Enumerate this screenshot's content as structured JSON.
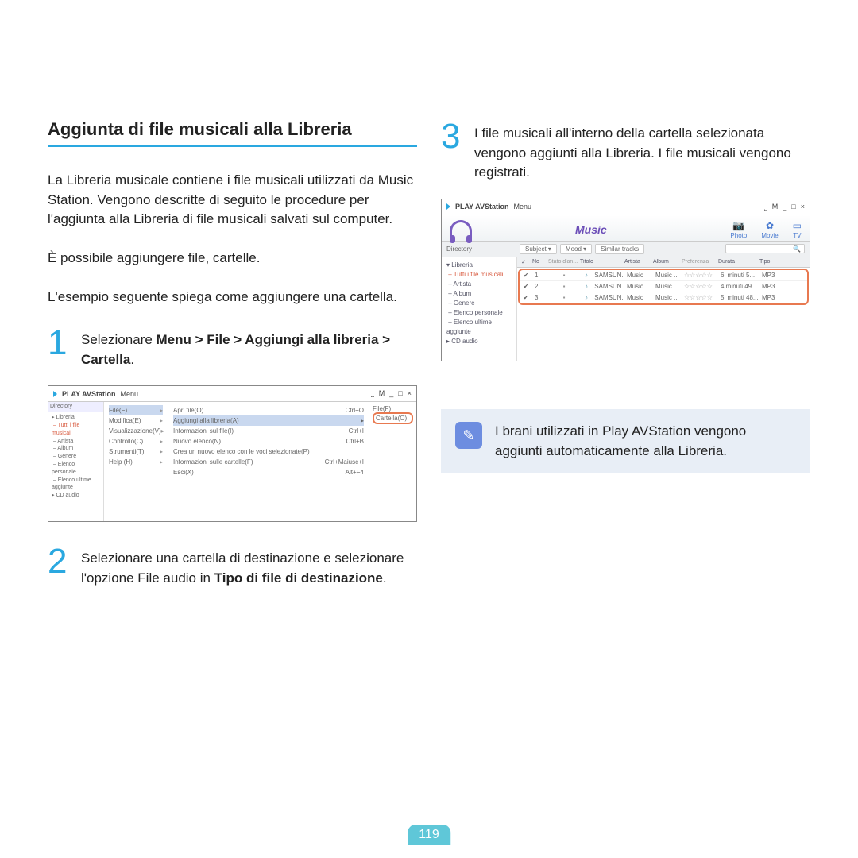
{
  "heading": "Aggiunta di file musicali alla Libreria",
  "intro1": "La Libreria musicale contiene i file musicali utilizzati da Music Station. Vengono descritte di seguito le procedure per l'aggiunta alla Libreria di file musicali salvati sul computer.",
  "intro2": "È possibile aggiungere file, cartelle.",
  "intro3": "L'esempio seguente spiega come aggiungere una cartella.",
  "step1_pre": "Selezionare ",
  "step1_bold": "Menu > File > Aggiungi alla libreria > Cartella",
  "step1_post": ".",
  "step2_a": "Selezionare una cartella di destinazione e selezionare l'opzione File audio in ",
  "step2_b": "Tipo di file di destinazione",
  "step2_c": ".",
  "step3": "I file musicali all'interno della cartella selezionata vengono aggiunti alla Libreria. I file musicali vengono registrati.",
  "note": "I brani utilizzati in Play AVStation vengono aggiunti automaticamente alla Libreria.",
  "pagenum": "119",
  "shot1": {
    "app": "PLAY AVStation",
    "menu_label": "Menu",
    "win_btns": [
      "⎵",
      "M",
      "_",
      "□",
      "×"
    ],
    "dir_label": "Directory",
    "tree": [
      "Libreria",
      "Tutti i file musicali",
      "Artista",
      "Album",
      "Genere",
      "Elenco personale",
      "Elenco ultime aggiunte",
      "CD audio"
    ],
    "filemenu": [
      "File(F)",
      "Modifica(E)",
      "Visualizzazione(V)",
      "Controllo(C)",
      "Strumenti(T)",
      "Help (H)"
    ],
    "submenu": [
      {
        "l": "Apri file(O)",
        "r": "Ctrl+O"
      },
      {
        "l": "Aggiungi alla libreria(A)",
        "r": ""
      },
      {
        "l": "Informazioni sul file(I)",
        "r": "Ctrl+I"
      },
      {
        "l": "Nuovo elenco(N)",
        "r": "Ctrl+B"
      },
      {
        "l": "Crea un nuovo elenco con le voci selezionate(P)",
        "r": ""
      },
      {
        "l": "Informazioni sulle cartelle(F)",
        "r": "Ctrl+Maiusc+I"
      },
      {
        "l": "Esci(X)",
        "r": "Alt+F4"
      }
    ],
    "flyout": [
      "File(F)",
      "Cartella(O)"
    ]
  },
  "shot2": {
    "app": "PLAY AVStation",
    "menu_label": "Menu",
    "win_btns": [
      "⎵",
      "M",
      "_",
      "□",
      "×"
    ],
    "music_label": "Music",
    "icons": [
      {
        "g": "📷",
        "t": "Photo"
      },
      {
        "g": "✿",
        "t": "Movie"
      },
      {
        "g": "▭",
        "t": "TV"
      }
    ],
    "dir_label": "Directory",
    "filters": [
      "Subject ▾",
      "Mood ▾",
      "Similar tracks"
    ],
    "tree": [
      "Libreria",
      "Tutti i file musicali",
      "Artista",
      "Album",
      "Genere",
      "Elenco personale",
      "Elenco ultime aggiunte",
      "CD audio"
    ],
    "thead": [
      "✓",
      "No",
      "Stato d'an...",
      "Titolo",
      "Artista",
      "Album",
      "Preferenza",
      "Durata",
      "Tipo"
    ],
    "rows": [
      {
        "no": "1",
        "title": "SAMSUN...",
        "artist": "Music",
        "album": "Music ...",
        "pref": "☆☆☆☆☆",
        "dur": "6i minuti  5...",
        "tp": "MP3"
      },
      {
        "no": "2",
        "title": "SAMSUN...",
        "artist": "Music",
        "album": "Music ...",
        "pref": "☆☆☆☆☆",
        "dur": "4 minuti 49...",
        "tp": "MP3"
      },
      {
        "no": "3",
        "title": "SAMSUN...",
        "artist": "Music",
        "album": "Music ...",
        "pref": "☆☆☆☆☆",
        "dur": "5i minuti 48...",
        "tp": "MP3"
      }
    ]
  }
}
